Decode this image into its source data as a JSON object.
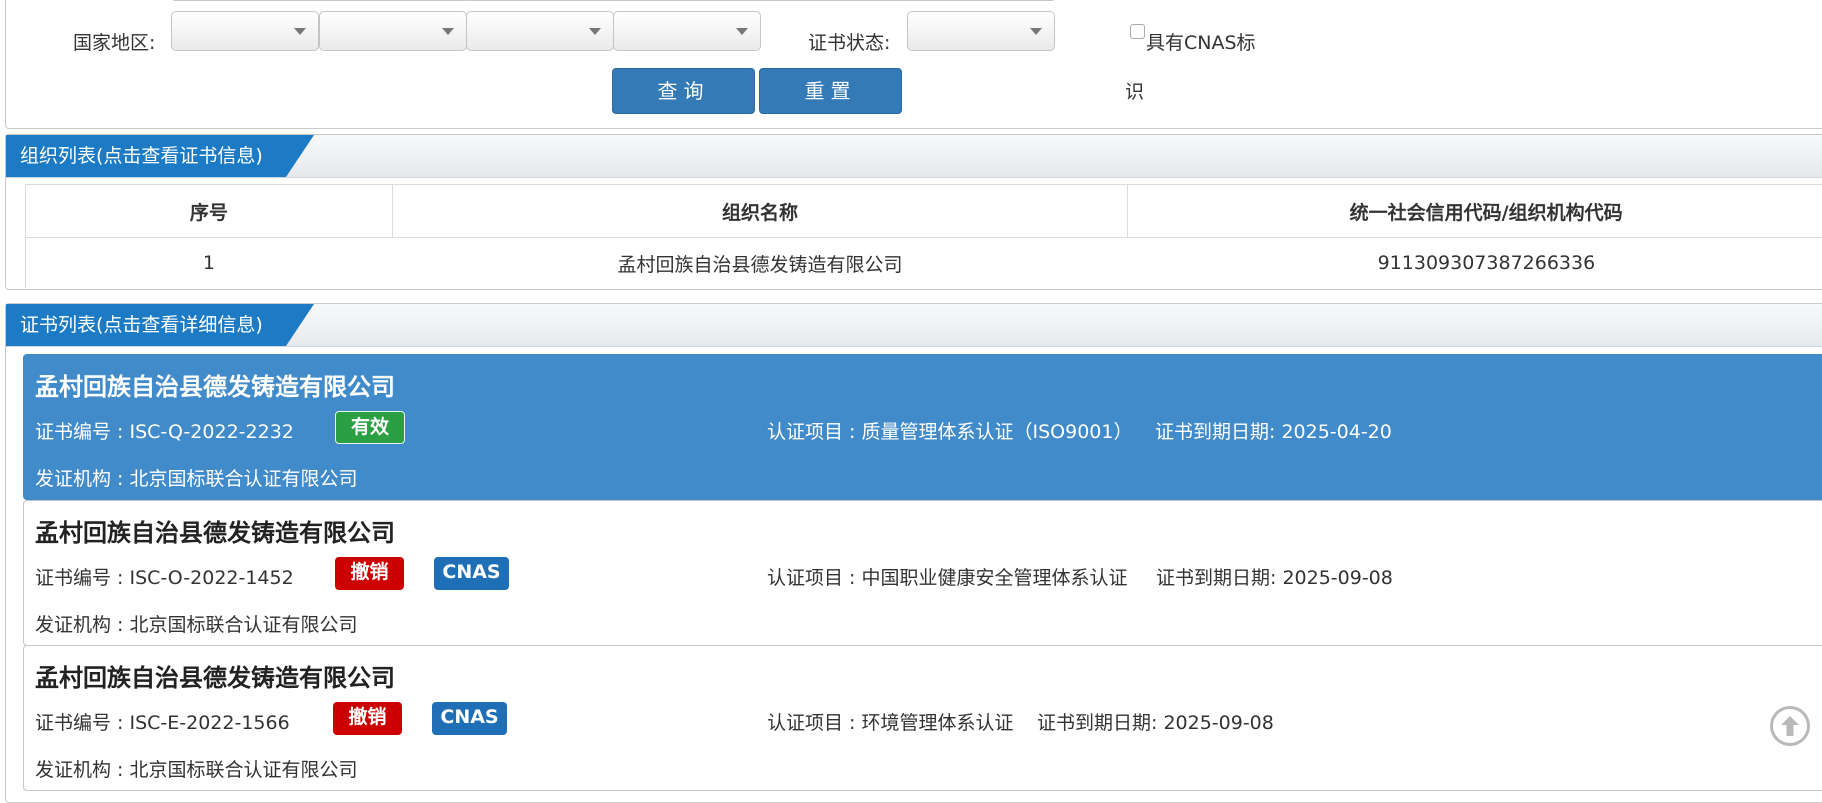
{
  "search": {
    "country_label": "国家地区:",
    "status_label": "证书状态:",
    "cnas_label_1": "具有CNAS标",
    "cnas_label_2": "识",
    "query_button": "查询",
    "reset_button": "重置"
  },
  "org_panel": {
    "title": "组织列表(点击查看证书信息)",
    "headers": [
      "序号",
      "组织名称",
      "统一社会信用代码/组织机构代码"
    ],
    "rows": [
      {
        "index": "1",
        "name": "孟村回族自治县德发铸造有限公司",
        "code": "911309307387266336"
      }
    ]
  },
  "cert_panel": {
    "title": "证书列表(点击查看详细信息)",
    "items": [
      {
        "company": "孟村回族自治县德发铸造有限公司",
        "cert_no": "证书编号 : ISC-Q-2022-2232",
        "status": "有效",
        "cnas": "",
        "project": "认证项目 : 质量管理体系认证（ISO9001）",
        "expiry": "证书到期日期: 2025-04-20",
        "issuer": "发证机构 : 北京国标联合认证有限公司"
      },
      {
        "company": "孟村回族自治县德发铸造有限公司",
        "cert_no": "证书编号 : ISC-O-2022-1452",
        "status": "撤销",
        "cnas": "CNAS",
        "project": "认证项目 : 中国职业健康安全管理体系认证",
        "expiry": "证书到期日期: 2025-09-08",
        "issuer": "发证机构 : 北京国标联合认证有限公司"
      },
      {
        "company": "孟村回族自治县德发铸造有限公司",
        "cert_no": "证书编号 : ISC-E-2022-1566",
        "status": "撤销",
        "cnas": "CNAS",
        "project": "认证项目 : 环境管理体系认证",
        "expiry": "证书到期日期: 2025-09-08",
        "issuer": "发证机构 : 北京国标联合认证有限公司"
      }
    ]
  },
  "colors": {
    "primary": "#337ab7",
    "active_card": "#428bca",
    "valid": "#2aa043",
    "revoked": "#cc0000",
    "cnas": "#1e6fb5"
  },
  "icons": {
    "scroll_top": "arrow-up-circle-icon",
    "dropdown": "caret-down-icon"
  }
}
